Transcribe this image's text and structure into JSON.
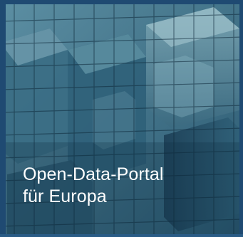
{
  "hero": {
    "image": "glass-facade-cubes-image",
    "title_line1": "Open-Data-Portal",
    "title_line2": "für Europa"
  },
  "colors": {
    "frame": "#1f4a72",
    "frame_bottom": "#2a5c86",
    "text": "#ffffff"
  }
}
